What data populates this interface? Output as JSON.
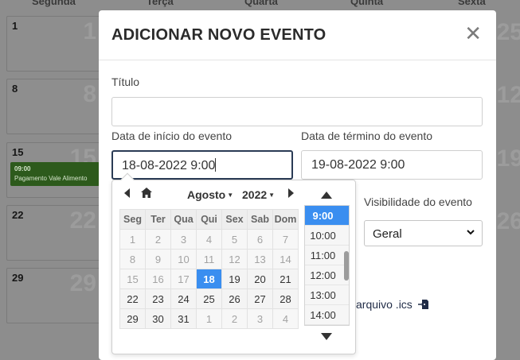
{
  "calendar": {
    "weekdays": [
      "Segunda",
      "Terça",
      "Quarta",
      "Quinta",
      "Sexta"
    ],
    "rows": [
      {
        "num": "1",
        "big": "1"
      },
      {
        "num": "8",
        "big": "8"
      },
      {
        "num": "15",
        "big": "15"
      },
      {
        "num": "22",
        "big": "22"
      },
      {
        "num": "29",
        "big": "29"
      }
    ],
    "right_col_big": [
      "25",
      "12",
      "19",
      "26"
    ],
    "event": {
      "time": "09:00",
      "title": "Pagamento Vale Alimento"
    }
  },
  "modal": {
    "title": "ADICIONAR NOVO EVENTO",
    "close_symbol": "✕",
    "titulo_label": "Título",
    "titulo_value": "",
    "start_label": "Data de início do evento",
    "start_value": "18-08-2022 9:00",
    "end_label": "Data de término do evento",
    "end_value": "19-08-2022 9:00",
    "visibility_label": "Visibilidade do evento",
    "visibility_value": "Geral",
    "ics_text": "arquivo .ics"
  },
  "datepicker": {
    "month": "Agosto",
    "year": "2022",
    "weekdays": [
      "Seg",
      "Ter",
      "Qua",
      "Qui",
      "Sex",
      "Sab",
      "Dom"
    ],
    "weeks": [
      [
        "1",
        "2",
        "3",
        "4",
        "5",
        "6",
        "7"
      ],
      [
        "8",
        "9",
        "10",
        "11",
        "12",
        "13",
        "14"
      ],
      [
        "15",
        "16",
        "17",
        "18",
        "19",
        "20",
        "21"
      ],
      [
        "22",
        "23",
        "24",
        "25",
        "26",
        "27",
        "28"
      ],
      [
        "29",
        "30",
        "31",
        "1",
        "2",
        "3",
        "4"
      ]
    ],
    "selected_day": "18",
    "times": [
      "9:00",
      "10:00",
      "11:00",
      "12:00",
      "13:00",
      "14:00"
    ],
    "selected_time": "9:00"
  },
  "colors": {
    "accent": "#3a8ef0",
    "event_green": "#2d5a1c",
    "overlay": "#8d8d8d"
  }
}
